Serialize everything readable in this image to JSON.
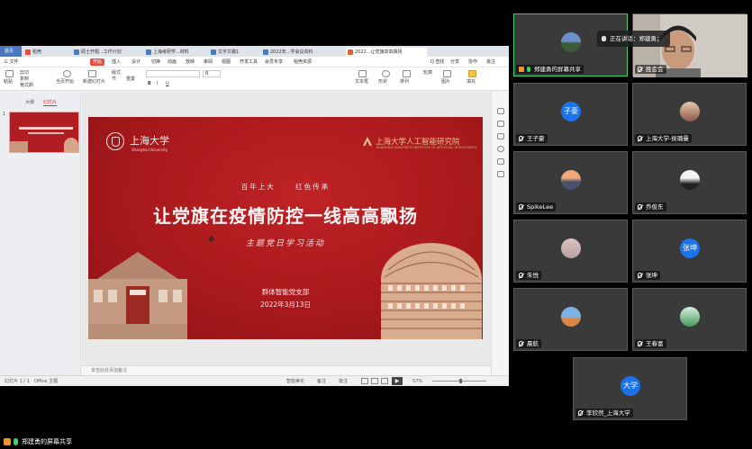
{
  "wps": {
    "home_tab": "首页",
    "tabs": [
      {
        "label": "稻壳",
        "color": "#e74c3c"
      },
      {
        "label": "硕士开题...工作计划",
        "color": "#4a78c2"
      },
      {
        "label": "上海考研学...材料",
        "color": "#4a78c2"
      },
      {
        "label": "文字文稿1",
        "color": "#4a78c2"
      },
      {
        "label": "2022年...学会议资料",
        "color": "#4a78c2"
      },
      {
        "label": "2022...让党旗高高飘扬",
        "color": "#e0642a"
      }
    ],
    "menus": [
      "三 文件",
      "开始",
      "插入",
      "设计",
      "切换",
      "动画",
      "放映",
      "审阅",
      "视图",
      "开发工具",
      "会员专享",
      "稻壳资源"
    ],
    "active_menu": "开始",
    "menu_right": [
      "Q 查找",
      "分享",
      "协作",
      "批注"
    ],
    "toolbar": {
      "paste": "粘贴",
      "cut": "剪切",
      "copy": "复制",
      "format": "格式刷",
      "slide_from": "当页开始",
      "new_slide": "新建幻灯片",
      "layout": "版式",
      "section": "节",
      "reset": "重置",
      "font_size": "0",
      "textbox": "文本框",
      "shape": "形状",
      "arrange": "排列",
      "outline": "轮廓",
      "picture": "图片",
      "fill": "填充"
    },
    "panel_tabs": [
      "大纲",
      "幻灯片"
    ],
    "thumb_number": "1",
    "notes_placeholder": "单击此处添加备注",
    "status": {
      "slide_count": "幻灯片 1 / 1",
      "theme": "Office 主题",
      "beautify": "智能美化",
      "notes": "备注",
      "comments": "批注",
      "zoom": "57%"
    }
  },
  "slide": {
    "university": "上海大学",
    "university_en": "Shanghai University",
    "institute": "上海大学人工智能研究院",
    "institute_en": "SHANGHAI UNIVERSITY INSTITUTE OF ARTIFICIAL INTELLIGENCE",
    "kicker": "百年上大 红色传承",
    "title": "让党旗在疫情防控一线高高飘扬",
    "subtitle": "主题党日学习活动",
    "organizer": "群体智能党支部",
    "date": "2022年3月13日"
  },
  "share_bar": {
    "label": "郑建勇的屏幕共享"
  },
  "speech_tip": "正在讲话：郑建勇；",
  "participants": [
    {
      "name": "郑建勇的屏幕共享",
      "avatar": "landscape",
      "speaking": true,
      "host": true,
      "mic": "on"
    },
    {
      "name": "胜会会",
      "avatar": "camera",
      "speaking": false,
      "host": false,
      "mic": "off"
    },
    {
      "name": "王子豪",
      "avatar": "子豪",
      "speaking": false,
      "host": false,
      "mic": "off"
    },
    {
      "name": "上海大学-侯璐曼",
      "avatar": "photo-pink",
      "speaking": false,
      "host": false,
      "mic": "off"
    },
    {
      "name": "SpikeLee",
      "avatar": "photo-city",
      "speaking": false,
      "host": false,
      "mic": "off"
    },
    {
      "name": "乔俊东",
      "avatar": "photo-person",
      "speaking": false,
      "host": false,
      "mic": "off"
    },
    {
      "name": "朱悦",
      "avatar": "photo-cat",
      "speaking": false,
      "host": false,
      "mic": "off"
    },
    {
      "name": "张坤",
      "avatar": "张坤",
      "speaking": false,
      "host": false,
      "mic": "off"
    },
    {
      "name": "晨航",
      "avatar": "photo-sky",
      "speaking": false,
      "host": false,
      "mic": "off"
    },
    {
      "name": "王春富",
      "avatar": "photo-green",
      "speaking": false,
      "host": false,
      "mic": "off"
    },
    {
      "name": "李欣然_上海大学",
      "avatar": "大学",
      "speaking": false,
      "host": false,
      "mic": "off"
    }
  ]
}
